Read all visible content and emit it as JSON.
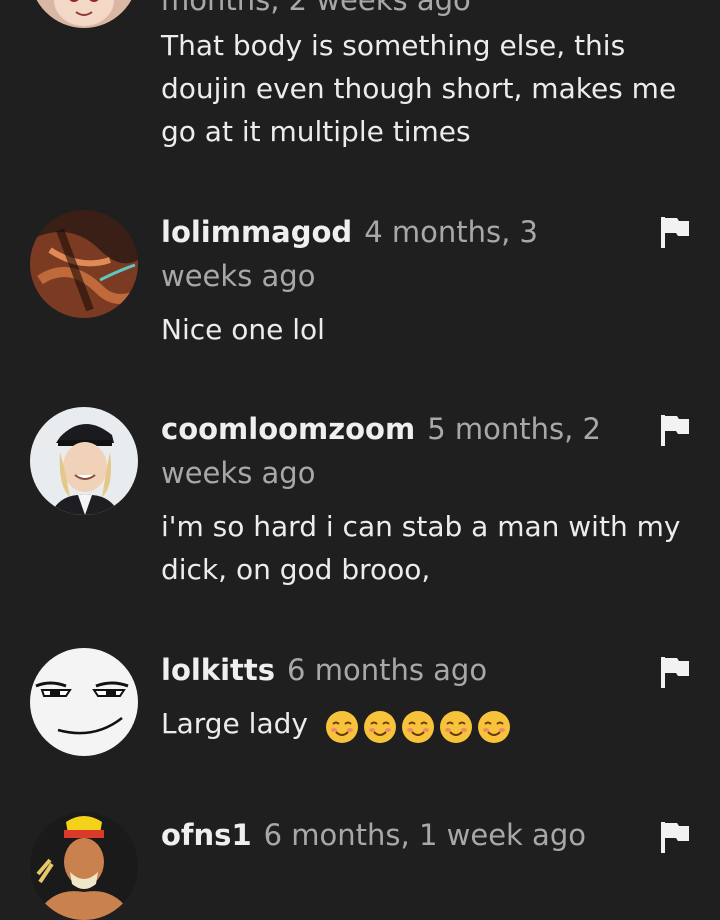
{
  "comments": [
    {
      "username": "",
      "timestamp": "months, 2 weeks ago",
      "text": "That body is something else, this doujin even though short, makes me go at it multiple times"
    },
    {
      "username": "lolimmagod",
      "timestamp": "4 months, 3 weeks ago",
      "text": "Nice one lol"
    },
    {
      "username": "coomloomzoom",
      "timestamp": "5 months, 2 weeks ago",
      "text": "i'm so hard i can stab a man with my dick, on god brooo,"
    },
    {
      "username": "lolkitts",
      "timestamp": "6 months ago",
      "text": "Large lady",
      "emoji": "smiling-face-icon",
      "emoji_count": 5
    },
    {
      "username": "ofns1",
      "timestamp": "6 months, 1 week ago",
      "text": ""
    }
  ],
  "icons": {
    "flag": "flag-icon",
    "emoji": "smiling-face-icon"
  },
  "colors": {
    "background": "#1f1f1f",
    "username": "#efefef",
    "timestamp": "#a8a8a8",
    "text": "#ececec"
  }
}
